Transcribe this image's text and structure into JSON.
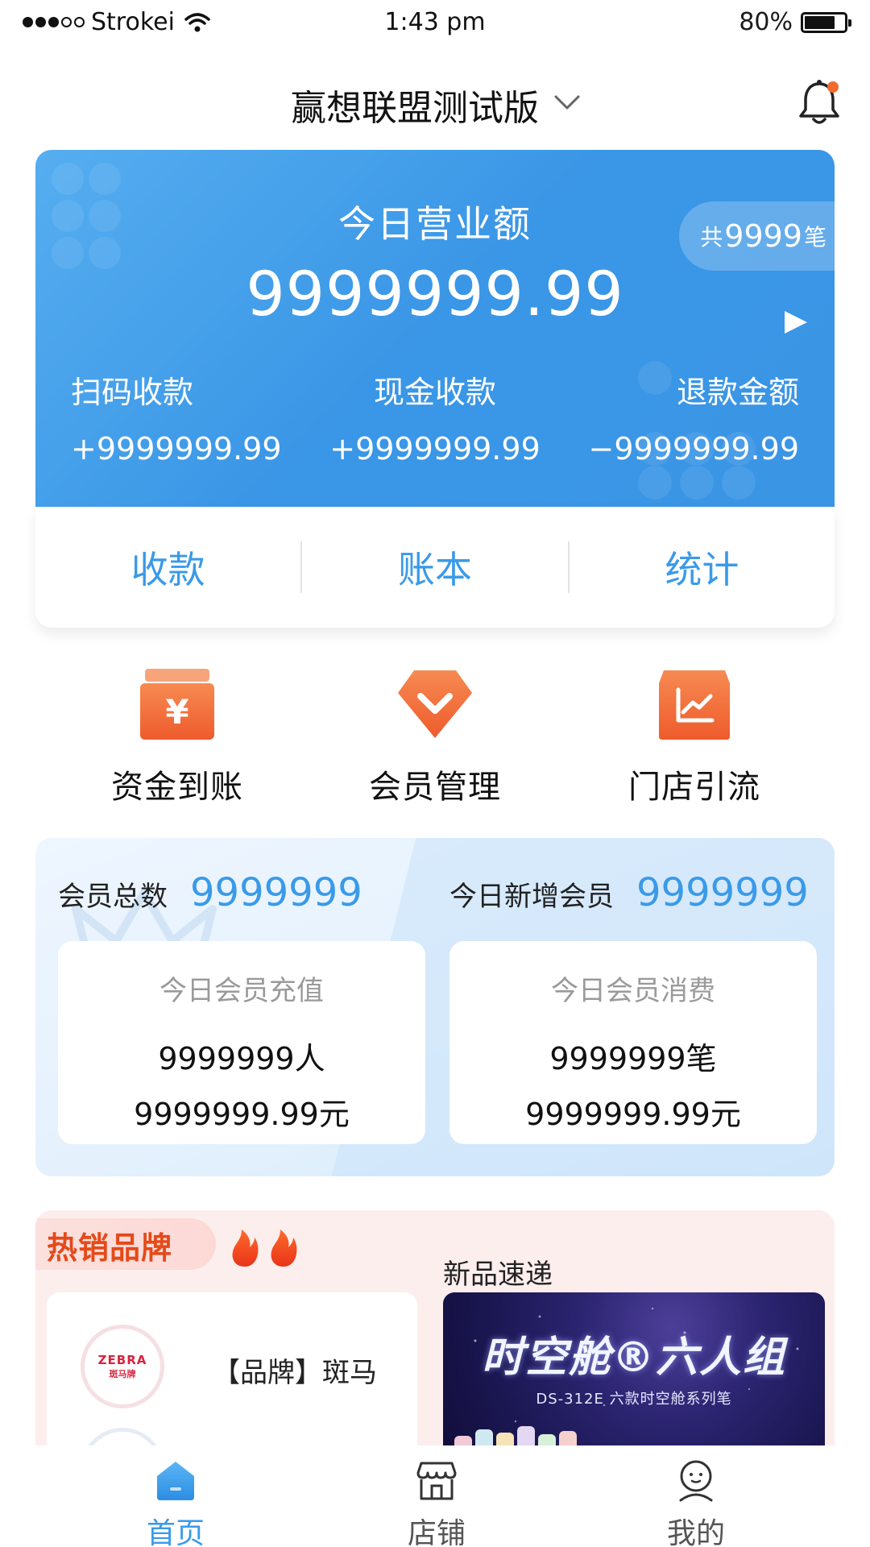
{
  "status_bar": {
    "carrier": "Strokei",
    "time": "1:43 pm",
    "battery": "80%"
  },
  "header": {
    "title": "赢想联盟测试版"
  },
  "revenue": {
    "label": "今日营业额",
    "amount": "9999999.99",
    "count_prefix": "共",
    "count": "9999",
    "count_suffix": "笔",
    "columns": [
      {
        "label": "扫码收款",
        "value": "+9999999.99"
      },
      {
        "label": "现金收款",
        "value": "+9999999.99"
      },
      {
        "label": "退款金额",
        "value": "−9999999.99"
      }
    ]
  },
  "actions": [
    "收款",
    "账本",
    "统计"
  ],
  "features": [
    {
      "label": "资金到账",
      "icon": "wallet-yen-icon"
    },
    {
      "label": "会员管理",
      "icon": "diamond-icon"
    },
    {
      "label": "门店引流",
      "icon": "store-chart-icon"
    }
  ],
  "members": {
    "total_label": "会员总数",
    "total_value": "9999999",
    "new_label": "今日新增会员",
    "new_value": "9999999",
    "recharge": {
      "title": "今日会员充值",
      "line1": "9999999人",
      "line2": "9999999.99元"
    },
    "consume": {
      "title": "今日会员消费",
      "line1": "9999999笔",
      "line2": "9999999.99元"
    }
  },
  "hot": {
    "title": "热销品牌",
    "new_title": "新品速递",
    "brand_name": "【品牌】斑马",
    "brand_logo_text": "ZEBRA",
    "brand_logo_sub": "斑马牌",
    "promo_title": "时空舱®六人组",
    "promo_subtitle": "DS-312E 六款时空舱系列笔"
  },
  "tabbar": [
    {
      "label": "首页",
      "icon": "home-icon",
      "active": true
    },
    {
      "label": "店铺",
      "icon": "shop-icon",
      "active": false
    },
    {
      "label": "我的",
      "icon": "profile-icon",
      "active": false
    }
  ],
  "colors": {
    "accent": "#3a9ae8",
    "orange": "#f06a3b",
    "hot_red": "#e44a1a"
  }
}
